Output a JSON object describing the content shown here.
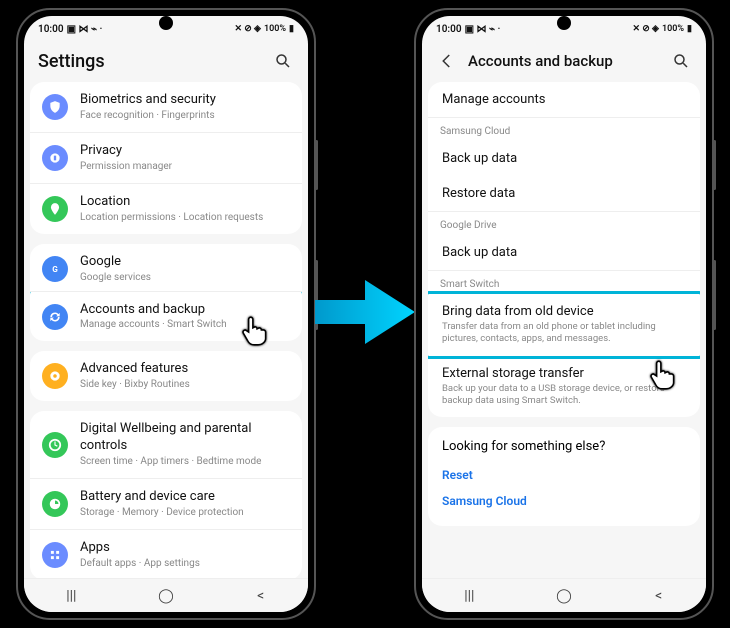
{
  "status": {
    "time": "10:00",
    "battery": "100%"
  },
  "nav": {
    "recent": "|||",
    "home": "◯",
    "back": "<"
  },
  "arrow_color": "#00b4d8",
  "left": {
    "title": "Settings",
    "groups": [
      {
        "rows": [
          {
            "icon": "shield",
            "color": "#6b8cff",
            "title": "Biometrics and security",
            "sub": "Face recognition  ·  Fingerprints"
          },
          {
            "icon": "privacy",
            "color": "#6b8cff",
            "title": "Privacy",
            "sub": "Permission manager"
          },
          {
            "icon": "pin",
            "color": "#34c759",
            "title": "Location",
            "sub": "Location permissions  ·  Location requests"
          }
        ]
      },
      {
        "rows": [
          {
            "icon": "g",
            "color": "#4285f4",
            "title": "Google",
            "sub": "Google services"
          },
          {
            "icon": "sync",
            "color": "#4285f4",
            "title": "Accounts and backup",
            "sub": "Manage accounts  ·  Smart Switch",
            "hl": true
          }
        ]
      },
      {
        "rows": [
          {
            "icon": "adv",
            "color": "#ffb020",
            "title": "Advanced features",
            "sub": "Side key  ·  Bixby Routines"
          }
        ]
      },
      {
        "rows": [
          {
            "icon": "dw",
            "color": "#34c759",
            "title": "Digital Wellbeing and parental controls",
            "sub": "Screen time  ·  App timers  ·  Bedtime mode"
          },
          {
            "icon": "bat",
            "color": "#34c759",
            "title": "Battery and device care",
            "sub": "Storage  ·  Memory  ·  Device protection"
          },
          {
            "icon": "apps",
            "color": "#6b8cff",
            "title": "Apps",
            "sub": "Default apps  ·  App settings"
          }
        ]
      }
    ]
  },
  "right": {
    "title": "Accounts and backup",
    "manage": "Manage accounts",
    "sections": [
      {
        "header": "Samsung Cloud",
        "rows": [
          {
            "t": "Back up data"
          },
          {
            "t": "Restore data"
          }
        ]
      },
      {
        "header": "Google Drive",
        "rows": [
          {
            "t": "Back up data"
          }
        ]
      },
      {
        "header": "Smart Switch",
        "rows": [
          {
            "t": "Bring data from old device",
            "s": "Transfer data from an old phone or tablet including pictures, contacts, apps, and messages.",
            "hl": true
          },
          {
            "t": "External storage transfer",
            "s": "Back up your data to a USB storage device, or restore backup data using Smart Switch."
          }
        ]
      }
    ],
    "footer": {
      "title": "Looking for something else?",
      "links": [
        "Reset",
        "Samsung Cloud"
      ]
    }
  }
}
